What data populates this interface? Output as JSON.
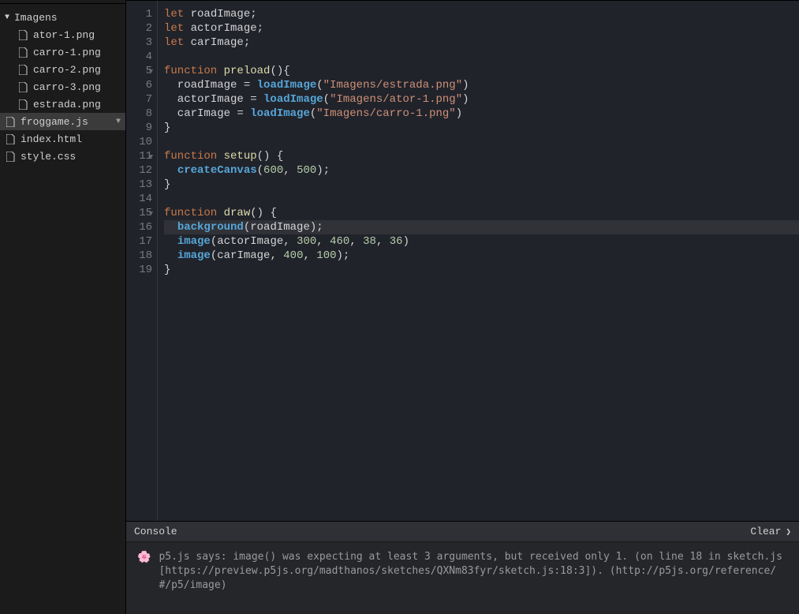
{
  "sidebar": {
    "folder": {
      "name": "Imagens",
      "expanded": true
    },
    "files_in_folder": [
      {
        "name": "ator-1.png"
      },
      {
        "name": "carro-1.png"
      },
      {
        "name": "carro-2.png"
      },
      {
        "name": "carro-3.png"
      },
      {
        "name": "estrada.png"
      }
    ],
    "root_files": [
      {
        "name": "froggame.js",
        "active": true,
        "menu": true
      },
      {
        "name": "index.html"
      },
      {
        "name": "style.css"
      }
    ]
  },
  "editor": {
    "highlight_line": 16,
    "fold_lines": [
      5,
      11,
      15
    ],
    "lines": [
      {
        "n": 1,
        "t": [
          [
            "k",
            "let "
          ],
          [
            "id",
            "roadImage"
          ],
          [
            "pn",
            ";"
          ]
        ]
      },
      {
        "n": 2,
        "t": [
          [
            "k",
            "let "
          ],
          [
            "id",
            "actorImage"
          ],
          [
            "pn",
            ";"
          ]
        ]
      },
      {
        "n": 3,
        "t": [
          [
            "k",
            "let "
          ],
          [
            "id",
            "carImage"
          ],
          [
            "pn",
            ";"
          ]
        ]
      },
      {
        "n": 4,
        "t": []
      },
      {
        "n": 5,
        "t": [
          [
            "k",
            "function "
          ],
          [
            "fn",
            "preload"
          ],
          [
            "pn",
            "(){"
          ]
        ]
      },
      {
        "n": 6,
        "t": [
          [
            "id",
            "  roadImage "
          ],
          [
            "pn",
            "= "
          ],
          [
            "call",
            "loadImage"
          ],
          [
            "pn",
            "("
          ],
          [
            "str",
            "\"Imagens/estrada.png\""
          ],
          [
            "pn",
            ")"
          ]
        ]
      },
      {
        "n": 7,
        "t": [
          [
            "id",
            "  actorImage "
          ],
          [
            "pn",
            "= "
          ],
          [
            "call",
            "loadImage"
          ],
          [
            "pn",
            "("
          ],
          [
            "str",
            "\"Imagens/ator-1.png\""
          ],
          [
            "pn",
            ")"
          ]
        ]
      },
      {
        "n": 8,
        "t": [
          [
            "id",
            "  carImage "
          ],
          [
            "pn",
            "= "
          ],
          [
            "call",
            "loadImage"
          ],
          [
            "pn",
            "("
          ],
          [
            "str",
            "\"Imagens/carro-1.png\""
          ],
          [
            "pn",
            ")"
          ]
        ]
      },
      {
        "n": 9,
        "t": [
          [
            "pn",
            "}"
          ]
        ]
      },
      {
        "n": 10,
        "t": []
      },
      {
        "n": 11,
        "t": [
          [
            "k",
            "function "
          ],
          [
            "fn",
            "setup"
          ],
          [
            "pn",
            "() {"
          ]
        ]
      },
      {
        "n": 12,
        "t": [
          [
            "pn",
            "  "
          ],
          [
            "call",
            "createCanvas"
          ],
          [
            "pn",
            "("
          ],
          [
            "num",
            "600"
          ],
          [
            "pn",
            ", "
          ],
          [
            "num",
            "500"
          ],
          [
            "pn",
            ");"
          ]
        ]
      },
      {
        "n": 13,
        "t": [
          [
            "pn",
            "}"
          ]
        ]
      },
      {
        "n": 14,
        "t": []
      },
      {
        "n": 15,
        "t": [
          [
            "k",
            "function "
          ],
          [
            "fn",
            "draw"
          ],
          [
            "pn",
            "() {"
          ]
        ]
      },
      {
        "n": 16,
        "t": [
          [
            "pn",
            "  "
          ],
          [
            "callb",
            "background"
          ],
          [
            "pn",
            "("
          ],
          [
            "id",
            "roadImage"
          ],
          [
            "pn",
            ");"
          ]
        ]
      },
      {
        "n": 17,
        "t": [
          [
            "pn",
            "  "
          ],
          [
            "call",
            "image"
          ],
          [
            "pn",
            "("
          ],
          [
            "id",
            "actorImage"
          ],
          [
            "pn",
            ", "
          ],
          [
            "num",
            "300"
          ],
          [
            "pn",
            ", "
          ],
          [
            "num",
            "460"
          ],
          [
            "pn",
            ", "
          ],
          [
            "num",
            "38"
          ],
          [
            "pn",
            ", "
          ],
          [
            "num",
            "36"
          ],
          [
            "pn",
            ")"
          ]
        ]
      },
      {
        "n": 18,
        "t": [
          [
            "pn",
            "  "
          ],
          [
            "call",
            "image"
          ],
          [
            "pn",
            "("
          ],
          [
            "id",
            "carImage"
          ],
          [
            "pn",
            ", "
          ],
          [
            "num",
            "400"
          ],
          [
            "pn",
            ", "
          ],
          [
            "num",
            "100"
          ],
          [
            "pn",
            ");"
          ]
        ]
      },
      {
        "n": 19,
        "t": [
          [
            "pn",
            "}"
          ]
        ]
      }
    ]
  },
  "console": {
    "title": "Console",
    "clear_label": "Clear",
    "icon": "🌸",
    "message": "p5.js says: image() was expecting at least 3 arguments, but received only 1. (on line 18 in sketch.js [https://preview.p5js.org/madthanos/sketches/QXNm83fyr/sketch.js:18:3]). (http://p5js.org/reference/#/p5/image)"
  }
}
